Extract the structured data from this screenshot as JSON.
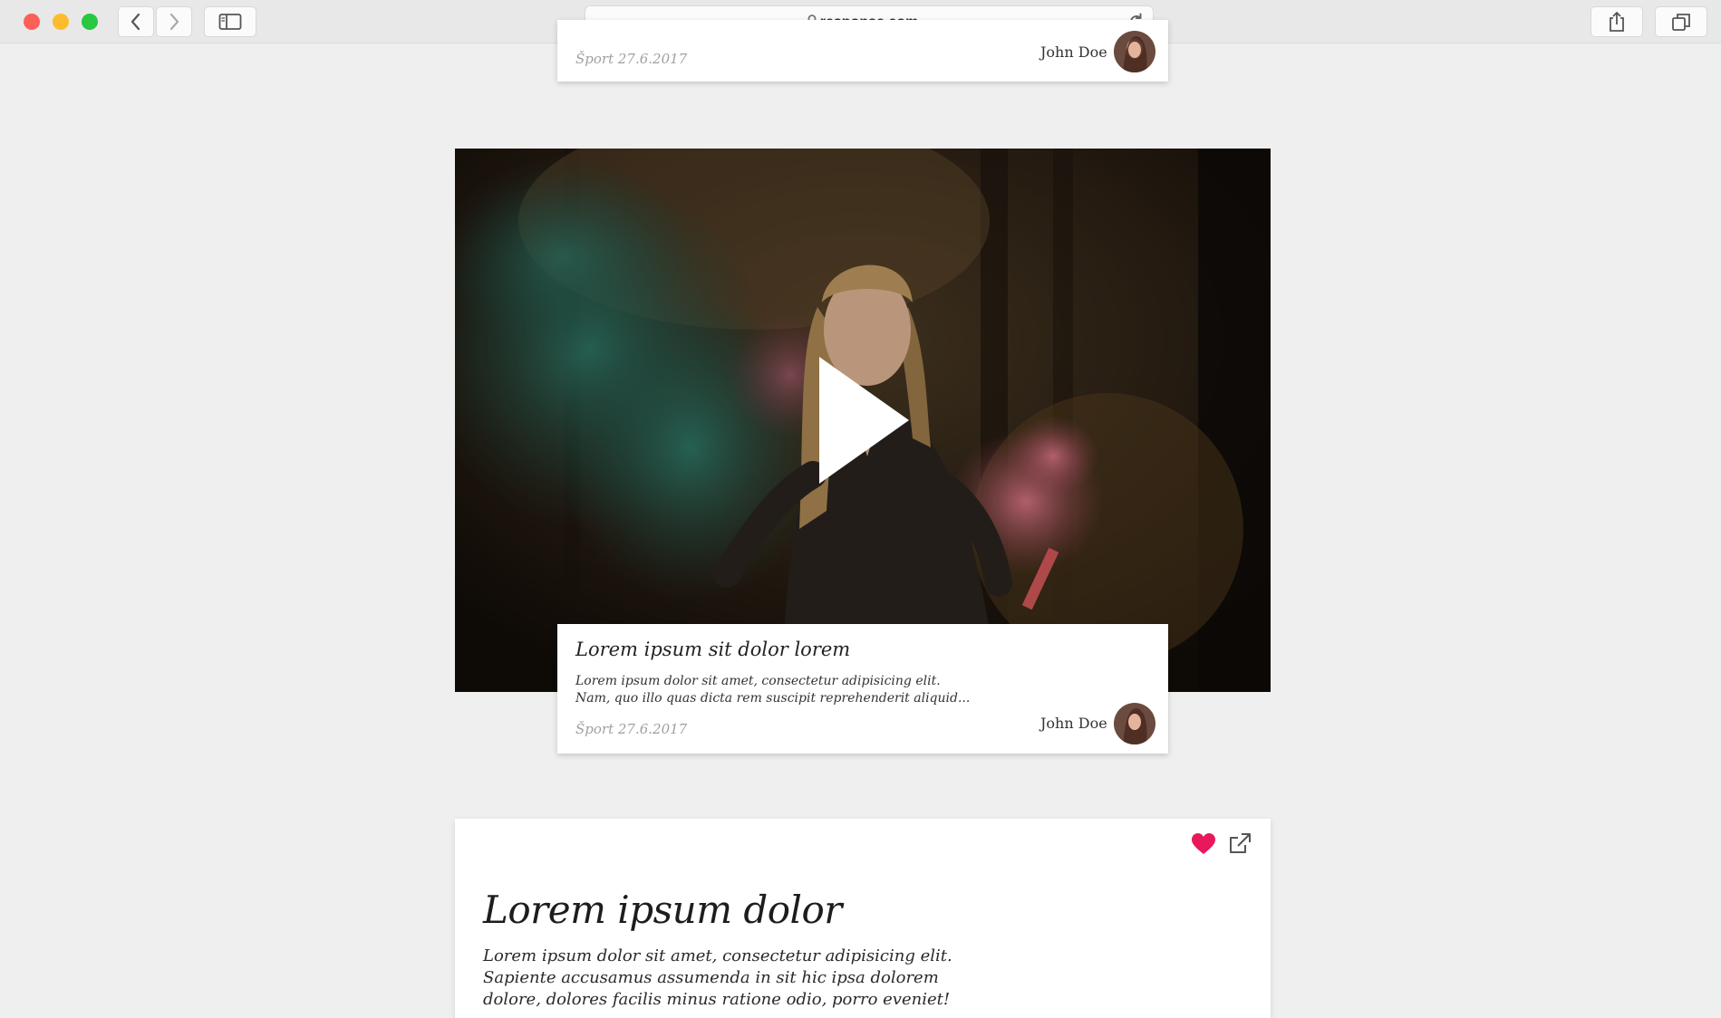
{
  "browser": {
    "url": "response.com",
    "buttons": [
      "back-icon",
      "forward-icon",
      "sidebar-icon",
      "share-icon",
      "tabs-icon",
      "reload-icon",
      "lock-icon"
    ]
  },
  "top_card": {
    "category_date": "Šport 27.6.2017",
    "author": "John Doe"
  },
  "video_card": {
    "title": "Lorem ipsum sit dolor lorem",
    "excerpt_line1": "Lorem ipsum dolor sit amet, consectetur adipisicing elit.",
    "excerpt_line2": "Nam, quo illo quas dicta rem suscipit reprehenderit aliquid...",
    "category_date": "Šport 27.6.2017",
    "author": "John Doe"
  },
  "article": {
    "title": "Lorem ipsum dolor",
    "body_line1": "Lorem ipsum dolor sit amet, consectetur adipisicing elit.",
    "body_line2": "Sapiente accusamus assumenda in sit hic ipsa dolorem",
    "body_line3": "dolore, dolores facilis minus ratione odio, porro eveniet!",
    "icons": [
      "heart-icon",
      "external-link-icon"
    ]
  },
  "colors": {
    "page_bg": "#efefef",
    "heart": "#e8185b"
  }
}
